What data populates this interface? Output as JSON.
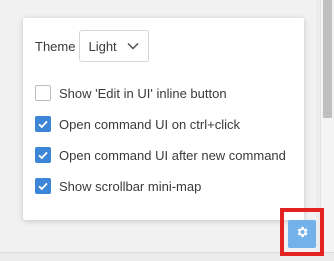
{
  "settings_panel": {
    "theme": {
      "label": "Theme",
      "selected": "Light"
    },
    "options": [
      {
        "label": "Show 'Edit in UI' inline button",
        "checked": false
      },
      {
        "label": "Open command UI on ctrl+click",
        "checked": true
      },
      {
        "label": "Open command UI after new command",
        "checked": true
      },
      {
        "label": "Show scrollbar mini-map",
        "checked": true
      }
    ]
  },
  "settings_toggle": {
    "icon": "gear-icon"
  },
  "colors": {
    "accent": "#3d85d6",
    "gear_button": "#73b1ea",
    "highlight": "#e32222"
  }
}
